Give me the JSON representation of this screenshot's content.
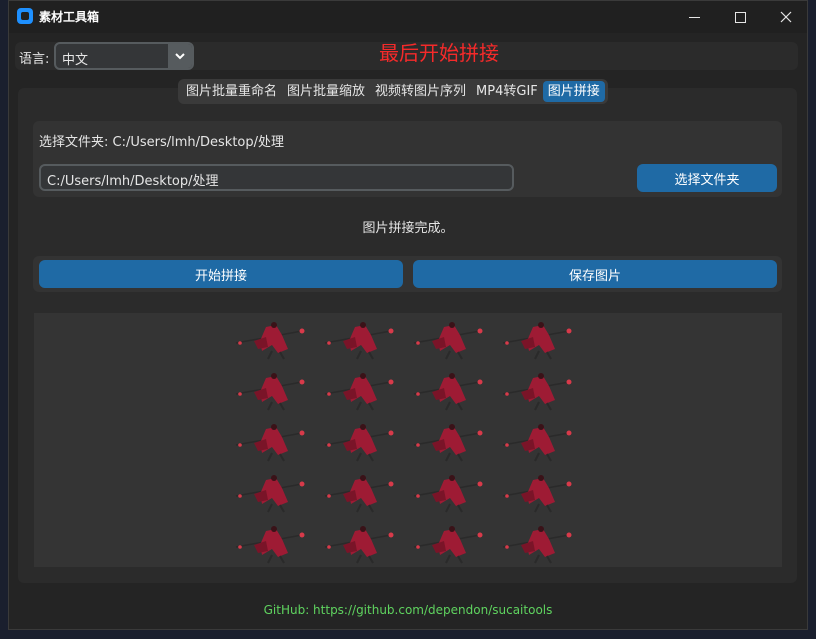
{
  "window": {
    "title": "素材工具箱"
  },
  "language": {
    "label": "语言:",
    "value": "中文"
  },
  "status_text": "最后开始拼接",
  "tabs": [
    {
      "label": "图片批量重命名",
      "active": false
    },
    {
      "label": "图片批量缩放",
      "active": false
    },
    {
      "label": "视频转图片序列",
      "active": false
    },
    {
      "label": "MP4转GIF",
      "active": false
    },
    {
      "label": "图片拼接",
      "active": true
    }
  ],
  "folder": {
    "label": "选择文件夹: C:/Users/lmh/Desktop/处理",
    "input_value": "C:/Users/lmh/Desktop/处理",
    "choose_button": "选择文件夹"
  },
  "complete_message": "图片拼接完成。",
  "actions": {
    "start_button": "开始拼接",
    "save_button": "保存图片"
  },
  "preview": {
    "rows": 5,
    "cols": 4
  },
  "footer": {
    "github": "GitHub: https://github.com/dependon/sucaitools"
  },
  "colors": {
    "accent": "#1f6aa5",
    "status_red": "#f52a2a",
    "github_green": "#5fd35f",
    "sprite_body": "#9e1b34"
  }
}
